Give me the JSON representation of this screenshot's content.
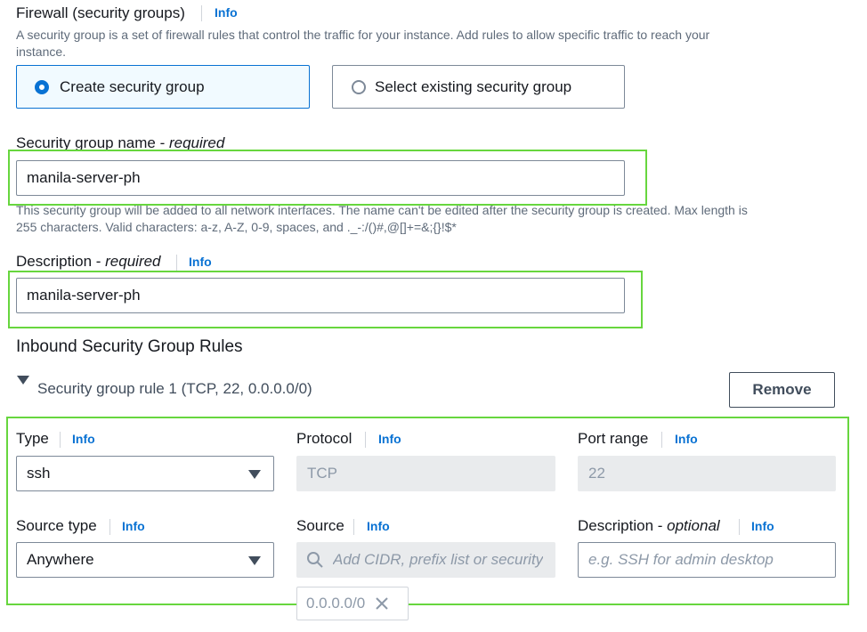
{
  "firewall": {
    "title": "Firewall (security groups)",
    "info": "Info",
    "description_line1": "A security group is a set of firewall rules that control the traffic for your instance. Add rules to allow specific traffic to reach your",
    "description_line2": "instance.",
    "options": [
      {
        "label": "Create security group",
        "selected": true
      },
      {
        "label": "Select existing security group",
        "selected": false
      }
    ]
  },
  "sg_name": {
    "label": "Security group name - ",
    "required": "required",
    "value": "manila-server-ph",
    "help_line1": "This security group will be added to all network interfaces. The name can't be edited after the security group is created. Max length is",
    "help_line2": "255 characters. Valid characters: a-z, A-Z, 0-9, spaces, and ._-:/()#,@[]+=&;{}!$*"
  },
  "description": {
    "label": "Description - ",
    "required": "required",
    "info": "Info",
    "value": "manila-server-ph"
  },
  "inbound": {
    "title": "Inbound Security Group Rules",
    "rule_title": "Security group rule 1 (TCP, 22, 0.0.0.0/0)",
    "remove_label": "Remove",
    "type": {
      "label": "Type",
      "info": "Info",
      "value": "ssh"
    },
    "protocol": {
      "label": "Protocol",
      "info": "Info",
      "value": "TCP"
    },
    "port_range": {
      "label": "Port range",
      "info": "Info",
      "value": "22"
    },
    "source_type": {
      "label": "Source type",
      "info": "Info",
      "value": "Anywhere"
    },
    "source": {
      "label": "Source",
      "info": "Info",
      "placeholder": "Add CIDR, prefix list or security",
      "token": "0.0.0.0/0"
    },
    "rule_description": {
      "label": "Description - ",
      "optional": "optional",
      "info": "Info",
      "placeholder": "e.g. SSH for admin desktop"
    }
  },
  "colors": {
    "accent": "#0972d3",
    "highlight": "#67d63e",
    "text": "#16191f"
  }
}
